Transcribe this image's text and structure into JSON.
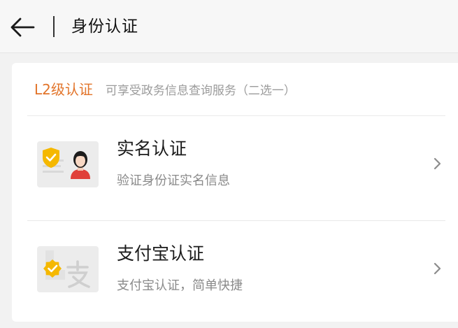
{
  "header": {
    "title": "身份认证"
  },
  "section": {
    "level_label": "L2级认证",
    "description": "可享受政务信息查询服务（二选一）"
  },
  "items": [
    {
      "title": "实名认证",
      "subtitle": "验证身份证实名信息",
      "icon": "id-card-shield-icon"
    },
    {
      "title": "支付宝认证",
      "subtitle": "支付宝认证，简单快捷",
      "icon": "alipay-badge-icon"
    }
  ],
  "colors": {
    "accent": "#e2742a",
    "shield_yellow": "#f5b800",
    "avatar_red": "#e0403a"
  }
}
